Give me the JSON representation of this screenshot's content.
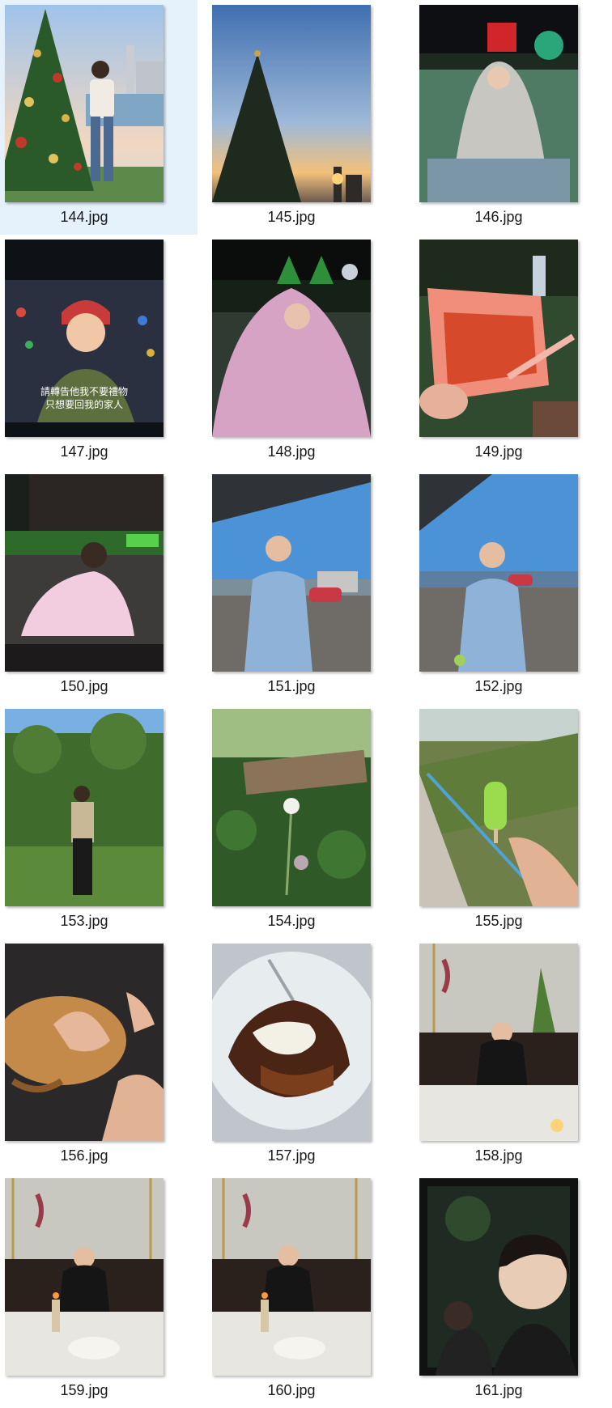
{
  "window": {
    "view": "large-icons"
  },
  "files": [
    {
      "name": "144.jpg",
      "selected": true,
      "icon": "photo-christmas-tree-harbor"
    },
    {
      "name": "145.jpg",
      "selected": false,
      "icon": "photo-tree-silhouette-sunset"
    },
    {
      "name": "146.jpg",
      "selected": false,
      "icon": "photo-person-in-blanket"
    },
    {
      "name": "147.jpg",
      "selected": false,
      "icon": "photo-movie-screen-child"
    },
    {
      "name": "148.jpg",
      "selected": false,
      "icon": "photo-person-pink-blanket"
    },
    {
      "name": "149.jpg",
      "selected": false,
      "icon": "photo-noodle-bowl"
    },
    {
      "name": "150.jpg",
      "selected": false,
      "icon": "photo-outdoor-cinema"
    },
    {
      "name": "151.jpg",
      "selected": false,
      "icon": "photo-man-blue-shirt"
    },
    {
      "name": "152.jpg",
      "selected": false,
      "icon": "photo-man-blue-shirt-rail"
    },
    {
      "name": "153.jpg",
      "selected": false,
      "icon": "photo-man-in-garden"
    },
    {
      "name": "154.jpg",
      "selected": false,
      "icon": "photo-dandelion-garden"
    },
    {
      "name": "155.jpg",
      "selected": false,
      "icon": "photo-green-popsicle"
    },
    {
      "name": "156.jpg",
      "selected": false,
      "icon": "photo-orange-cat"
    },
    {
      "name": "157.jpg",
      "selected": false,
      "icon": "photo-chocolate-cake"
    },
    {
      "name": "158.jpg",
      "selected": false,
      "icon": "photo-restaurant-dinner"
    },
    {
      "name": "159.jpg",
      "selected": false,
      "icon": "photo-restaurant-birthday"
    },
    {
      "name": "160.jpg",
      "selected": false,
      "icon": "photo-restaurant-birthday-2"
    },
    {
      "name": "161.jpg",
      "selected": false,
      "icon": "photo-selfie-dark"
    }
  ],
  "movie_subtitle": {
    "line1": "請轉告他我不要禮物",
    "line2": "只想要回我的家人"
  },
  "colors": {
    "selection": "#e5f1fb",
    "label_text": "#1a1a1a"
  }
}
